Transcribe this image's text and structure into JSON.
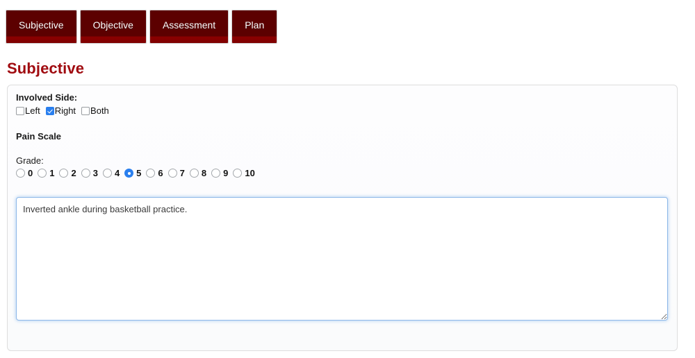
{
  "tabs": [
    {
      "label": "Subjective",
      "active": true
    },
    {
      "label": "Objective",
      "active": false
    },
    {
      "label": "Assessment",
      "active": false
    },
    {
      "label": "Plan",
      "active": false
    }
  ],
  "page": {
    "heading": "Subjective"
  },
  "involved_side": {
    "label": "Involved Side:",
    "options": [
      {
        "label": "Left",
        "checked": false
      },
      {
        "label": "Right",
        "checked": true
      },
      {
        "label": "Both",
        "checked": false
      }
    ]
  },
  "pain_scale": {
    "label": "Pain Scale",
    "grade_label": "Grade:",
    "selected": "5",
    "options": [
      "0",
      "1",
      "2",
      "3",
      "4",
      "5",
      "6",
      "7",
      "8",
      "9",
      "10"
    ]
  },
  "notes": {
    "value": "Inverted ankle during basketball practice.",
    "placeholder": ""
  },
  "colors": {
    "tab_background": "#5c0000",
    "tab_accent": "#8c0000",
    "heading": "#a00b10",
    "control_accent": "#2a7fee",
    "focus_border": "#8cb7e8",
    "panel_border": "#dddddd"
  }
}
